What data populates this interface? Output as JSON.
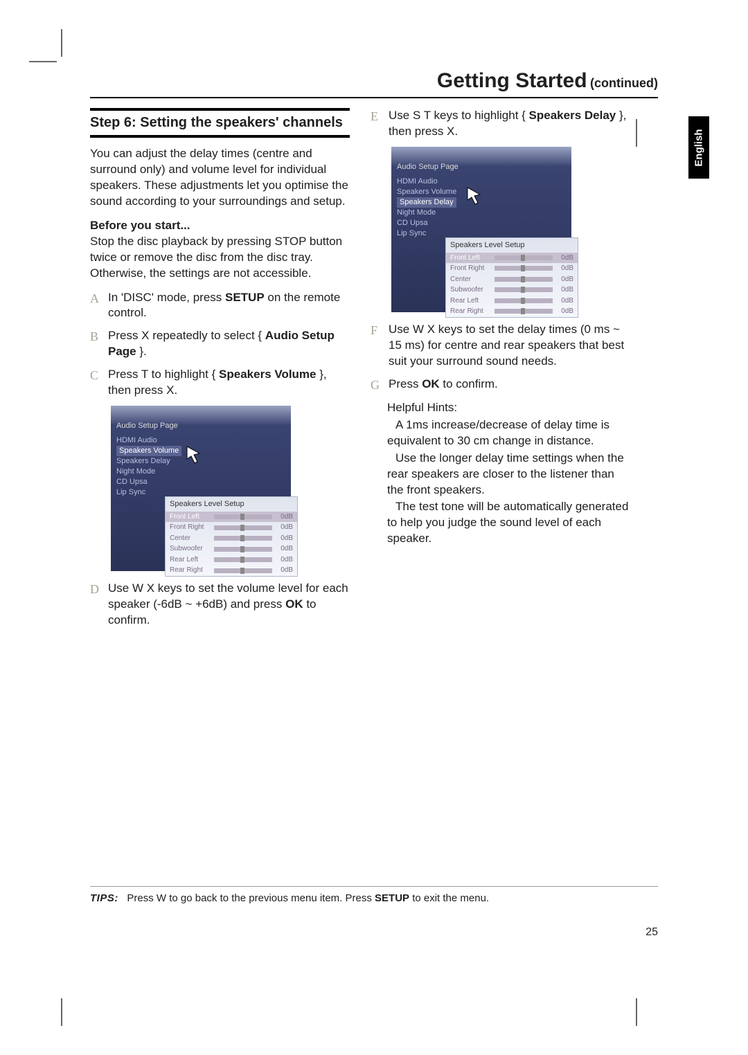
{
  "title": {
    "main": "Getting Started",
    "continued": "(continued)"
  },
  "language_tab": "English",
  "page_number": "25",
  "step6": {
    "heading": "Step 6:  Setting the speakers' channels",
    "intro": "You can adjust the delay times (centre and surround only) and volume level for individual speakers. These adjustments let you optimise the sound according to your surroundings and setup.",
    "before_label": "Before you start...",
    "before_text": "Stop the disc playback by pressing STOP button twice or remove the disc from the disc tray.  Otherwise, the settings are not accessible."
  },
  "steps": {
    "A": {
      "t1": "In 'DISC' mode, press ",
      "b1": "SETUP",
      "t2": " on the remote control."
    },
    "B": {
      "t1": "Press  X repeatedly to select { ",
      "b1": "Audio Setup Page",
      "t2": " }."
    },
    "C": {
      "t1": "Press  T to highlight { ",
      "b1": "Speakers Volume",
      "t2": " }, then press  X."
    },
    "D": {
      "t1": "Use  W X keys to set the volume level for each speaker (-6dB ~ +6dB) and press ",
      "b1": "OK",
      "t2": " to confirm."
    },
    "E": {
      "t1": "Use  S T keys to highlight { ",
      "b1": "Speakers Delay",
      "t2": " }, then press  X."
    },
    "F": {
      "t1": "Use  W X keys to set the delay times (0 ms ~ 15 ms) for centre and rear speakers that best suit your surround sound needs."
    },
    "G": {
      "t1": "Press ",
      "b1": "OK",
      "t2": " to confirm."
    }
  },
  "screenshot": {
    "title": "Audio Setup Page",
    "left_items": [
      "HDMI Audio",
      "Speakers Volume",
      "Speakers Delay",
      "Night Mode",
      "CD Upsa",
      "Lip Sync"
    ],
    "panel_title": "Speakers Level Setup",
    "rows": [
      {
        "name": "Front Left",
        "val": "0dB"
      },
      {
        "name": "Front Right",
        "val": "0dB"
      },
      {
        "name": "Center",
        "val": "0dB"
      },
      {
        "name": "Subwoofer",
        "val": "0dB"
      },
      {
        "name": "Rear Left",
        "val": "0dB"
      },
      {
        "name": "Rear Right",
        "val": "0dB"
      }
    ]
  },
  "hints": {
    "title": "Helpful Hints:",
    "h1": "A 1ms increase/decrease of delay time is equivalent to 30 cm change in distance.",
    "h2": "Use the longer delay time settings when the rear speakers are closer to the listener than the front speakers.",
    "h3": "The test tone will be automatically generated to help you judge the sound level of each speaker."
  },
  "tips": {
    "label": "TIPS:",
    "t1": "Press W to go back to the previous menu item.  Press ",
    "b1": "SETUP",
    "t2": " to exit the menu."
  }
}
